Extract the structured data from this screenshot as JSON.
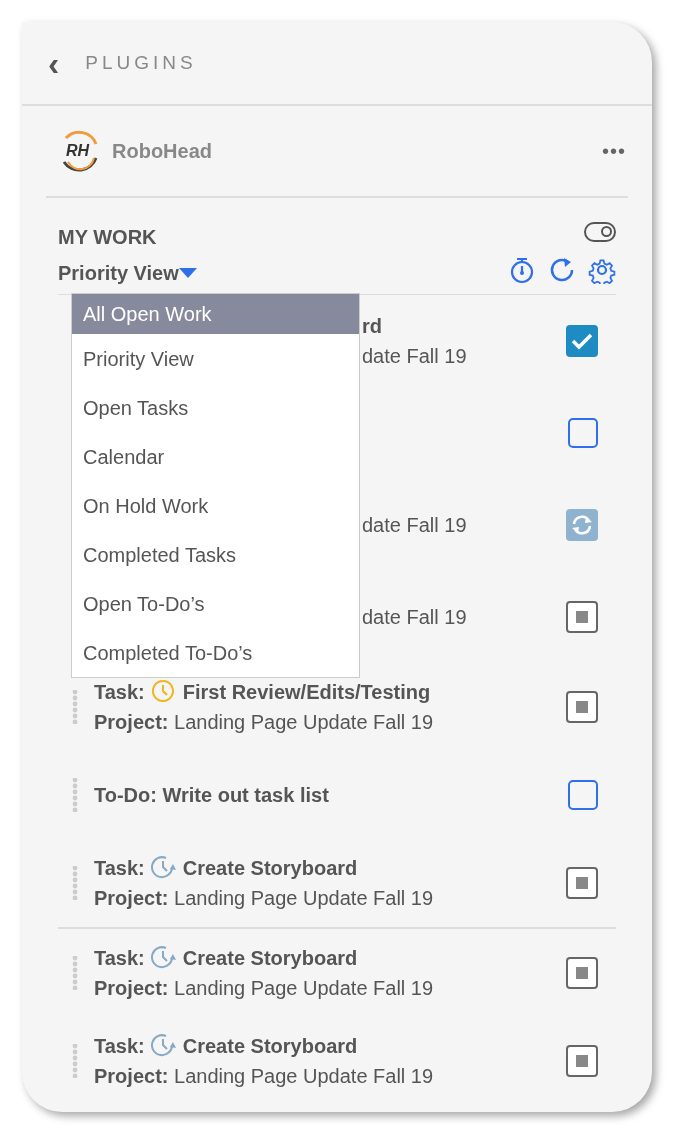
{
  "header": {
    "back": "‹",
    "title": "PLUGINS"
  },
  "plugin": {
    "name": "RoboHead",
    "logo_text": "RH",
    "menu": "•••"
  },
  "my_work": {
    "title": "MY WORK",
    "view": "Priority View",
    "toggle": {
      "on": true
    }
  },
  "dropdown": {
    "items": [
      {
        "label": "All Open Work",
        "selected": true
      },
      {
        "label": "Priority View",
        "selected": false
      },
      {
        "label": "Open Tasks",
        "selected": false
      },
      {
        "label": "Calendar",
        "selected": false
      },
      {
        "label": "On Hold Work",
        "selected": false
      },
      {
        "label": "Completed Tasks",
        "selected": false
      },
      {
        "label": "Open To-Do’s",
        "selected": false
      },
      {
        "label": "Completed To-Do’s",
        "selected": false
      }
    ]
  },
  "rows": [
    {
      "kind": "covered",
      "title": "rd",
      "project": "date Fall 19",
      "control": {
        "kind": "checkbox",
        "checked": true
      }
    },
    {
      "kind": "covered",
      "control": {
        "kind": "checkbox",
        "checked": false
      }
    },
    {
      "kind": "covered",
      "project": "date Fall 19",
      "control": {
        "kind": "sync"
      }
    },
    {
      "kind": "covered",
      "project": "date Fall 19",
      "control": {
        "kind": "stop"
      }
    },
    {
      "kind": "task",
      "type_label": "Task:",
      "clock": {
        "kind": "pending"
      },
      "title": "First Review/Edits/Testing",
      "project": "**Project:** Landing Page Update Fall 19",
      "control": {
        "kind": "stop"
      }
    },
    {
      "kind": "todo",
      "title": "To-Do: Write out task list",
      "control": {
        "kind": "checkbox",
        "checked": false
      }
    },
    {
      "kind": "task",
      "type_label": "Task:",
      "clock": {
        "kind": "recurring"
      },
      "title": "Create Storyboard",
      "project": "**Project:** Landing Page Update Fall 19",
      "control": {
        "kind": "stop"
      },
      "divider_after": true
    },
    {
      "kind": "task",
      "type_label": "Task:",
      "clock": {
        "kind": "recurring"
      },
      "title": "Create Storyboard",
      "project": "**Project:** Landing Page Update Fall 19",
      "control": {
        "kind": "stop"
      }
    },
    {
      "kind": "task",
      "type_label": "Task:",
      "clock": {
        "kind": "recurring"
      },
      "title": "Create Storyboard",
      "project": "**Project:** Landing Page Update Fall 19",
      "control": {
        "kind": "stop"
      }
    }
  ]
}
